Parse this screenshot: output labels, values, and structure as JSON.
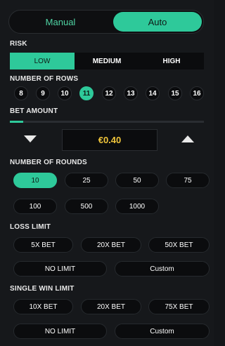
{
  "mode": {
    "manual": "Manual",
    "auto": "Auto"
  },
  "risk": {
    "label": "RISK",
    "options": [
      "LOW",
      "MEDIUM",
      "HIGH"
    ],
    "selected": "LOW"
  },
  "rows": {
    "label": "NUMBER OF ROWS",
    "options": [
      "8",
      "9",
      "10",
      "11",
      "12",
      "13",
      "14",
      "15",
      "16"
    ],
    "selected": "11"
  },
  "bet": {
    "label": "BET AMOUNT",
    "value": "€0.40",
    "slider_fraction": 0.07
  },
  "rounds": {
    "label": "NUMBER OF ROUNDS",
    "options": [
      "10",
      "25",
      "50",
      "75",
      "100",
      "500",
      "1000"
    ],
    "selected": "10"
  },
  "loss_limit": {
    "label": "LOSS LIMIT",
    "options": [
      "5X BET",
      "20X BET",
      "50X BET"
    ],
    "no_limit": "NO LIMIT",
    "custom": "Custom"
  },
  "win_limit": {
    "label": "SINGLE WIN LIMIT",
    "options": [
      "10X BET",
      "20X BET",
      "75X BET"
    ],
    "no_limit": "NO LIMIT",
    "custom": "Custom"
  },
  "colors": {
    "accent": "#2ec99a",
    "bet_value": "#f0c53b",
    "background": "#16181b"
  }
}
